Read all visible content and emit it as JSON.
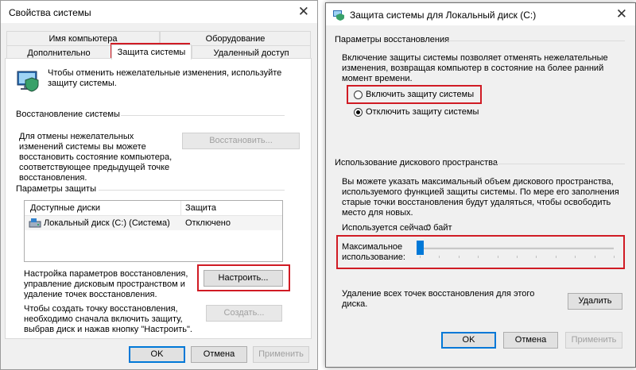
{
  "left_window": {
    "title": "Свойства системы",
    "tabs_row1": [
      "Имя компьютера",
      "Оборудование"
    ],
    "tabs_row2": [
      "Дополнительно",
      "Защита системы",
      "Удаленный доступ"
    ],
    "intro_text": "Чтобы отменить нежелательные изменения, используйте защиту системы.",
    "restore_group": "Восстановление системы",
    "restore_desc": "Для отмены нежелательных изменений системы вы можете восстановить состояние компьютера, соответствующее предыдущей точке восстановления.",
    "restore_button": "Восстановить...",
    "protection_group": "Параметры защиты",
    "table_headers": [
      "Доступные диски",
      "Защита"
    ],
    "table_rows": [
      {
        "disk": "Локальный диск (C:) (Система)",
        "status": "Отключено"
      }
    ],
    "configure_desc": "Настройка параметров восстановления, управление дисковым пространством и удаление точек восстановления.",
    "configure_button": "Настроить...",
    "create_desc": "Чтобы создать точку восстановления, необходимо сначала включить защиту, выбрав диск и нажав кнопку \"Настроить\".",
    "create_button": "Создать...",
    "ok": "OK",
    "cancel": "Отмена",
    "apply": "Применить"
  },
  "right_window": {
    "title": "Защита системы для Локальный диск (C:)",
    "restore_params_group": "Параметры восстановления",
    "restore_params_desc": "Включение защиты системы позволяет отменять нежелательные изменения, возвращая компьютер в состояние на более ранний момент времени.",
    "radio_enable": "Включить защиту системы",
    "radio_disable": "Отключить защиту системы",
    "selected_option": "disable",
    "disk_usage_group": "Использование дискового пространства",
    "disk_usage_desc": "Вы можете указать максимальный объем дискового пространства, используемого функцией защиты системы. По мере его заполнения старые точки восстановления будут удаляться, чтобы освободить место для новых.",
    "current_usage_label": "Используется сейчас:",
    "current_usage_value": "0 байт",
    "max_usage_label": "Максимальное использование:",
    "slider_value_fraction": 0.0,
    "delete_desc": "Удаление всех точек восстановления для этого диска.",
    "delete_button": "Удалить",
    "ok": "OK",
    "cancel": "Отмена",
    "apply": "Применить"
  },
  "colors": {
    "highlight_red": "#d01b24",
    "accent_blue": "#0078d7"
  },
  "icons": {
    "left_window_main": "computer-shield-icon",
    "right_window_title": "shield-icon",
    "disk": "drive-icon"
  }
}
